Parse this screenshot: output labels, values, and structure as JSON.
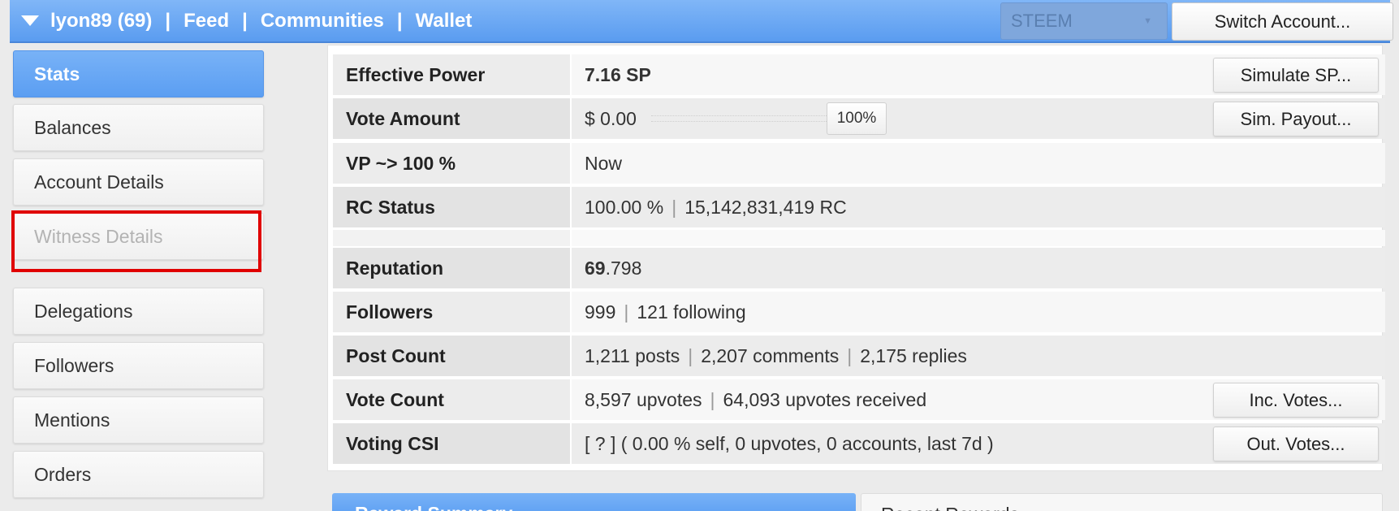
{
  "header": {
    "account": "lyon89 (69)",
    "nav_links": [
      "Feed",
      "Communities",
      "Wallet"
    ],
    "separator": "|",
    "chain_select_value": "STEEM",
    "switch_account_label": "Switch Account..."
  },
  "sidebar": {
    "items": [
      {
        "label": "Stats",
        "state": "active"
      },
      {
        "label": "Balances",
        "state": "normal"
      },
      {
        "label": "Account Details",
        "state": "normal"
      },
      {
        "label": "Witness Details",
        "state": "disabled"
      },
      {
        "label": "Delegations",
        "state": "normal"
      },
      {
        "label": "Followers",
        "state": "normal"
      },
      {
        "label": "Mentions",
        "state": "normal"
      },
      {
        "label": "Orders",
        "state": "normal"
      }
    ]
  },
  "stats": {
    "effective_power": {
      "label": "Effective Power",
      "value": "7.16 SP",
      "button": "Simulate SP..."
    },
    "vote_amount": {
      "label": "Vote Amount",
      "value": "$ 0.00",
      "slider_value": "100%",
      "button": "Sim. Payout..."
    },
    "vp": {
      "label": "VP ~> 100 %",
      "value": "Now"
    },
    "rc_status": {
      "label": "RC Status",
      "percent": "100.00 %",
      "rc": "15,142,831,419 RC"
    },
    "reputation": {
      "label": "Reputation",
      "whole": "69",
      "fraction": ".798"
    },
    "followers": {
      "label": "Followers",
      "followers": "999",
      "following": "121 following"
    },
    "post_count": {
      "label": "Post Count",
      "posts": "1,211 posts",
      "comments": "2,207 comments",
      "replies": "2,175 replies"
    },
    "vote_count": {
      "label": "Vote Count",
      "upvotes": "8,597 upvotes",
      "received": "64,093 upvotes received",
      "button": "Inc. Votes..."
    },
    "voting_csi": {
      "label": "Voting CSI",
      "value": "[ ? ] ( 0.00 % self, 0 upvotes, 0 accounts, last 7d )",
      "button": "Out. Votes..."
    }
  },
  "bottom_tabs": [
    "Reward Summary",
    "Recent Rewards"
  ],
  "colors": {
    "accent_blue": "#5b9ef2",
    "highlight_red": "#e00000"
  }
}
